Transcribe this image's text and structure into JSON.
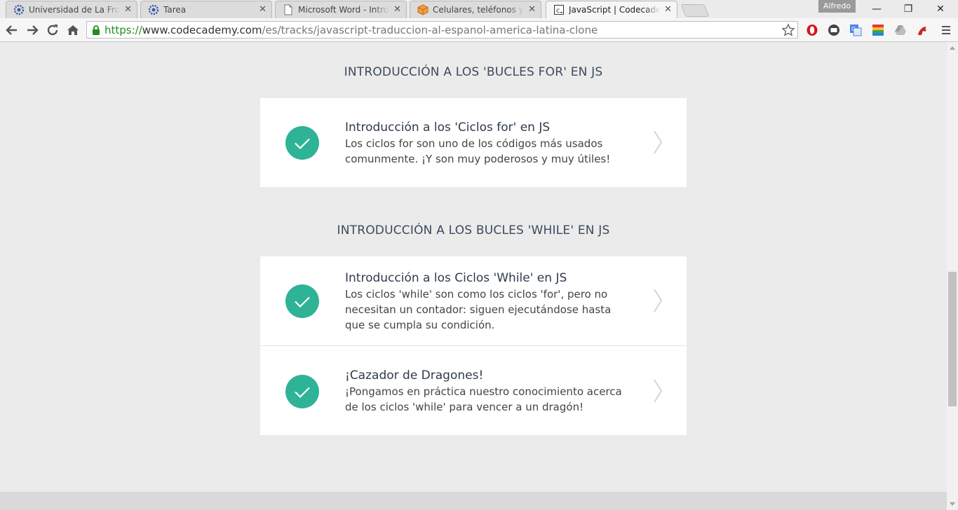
{
  "browser": {
    "tabs": [
      {
        "title": "Universidad de La Frontera",
        "favicon": "university-gear-icon",
        "active": false
      },
      {
        "title": "Tarea",
        "favicon": "university-gear-icon",
        "active": false
      },
      {
        "title": "Microsoft Word - Introducción",
        "favicon": "document-icon",
        "active": false
      },
      {
        "title": "Celulares, teléfonos y accesorios",
        "favicon": "box-icon",
        "active": false
      },
      {
        "title": "JavaScript | Codecademy",
        "favicon": "codecademy-icon",
        "active": true
      }
    ],
    "close_glyph": "✕",
    "profile_name": "Alfredo",
    "window_controls": {
      "minimize": "—",
      "restore": "❐",
      "close": "✕"
    },
    "address": {
      "scheme": "https://",
      "host": "www.codecademy.com",
      "path": "/es/tracks/javascript-traduccion-al-espanol-america-latina-clone"
    },
    "extensions": [
      "opera-icon",
      "screenshot-icon",
      "translate-icon",
      "color-grid-icon",
      "drive-icon",
      "dragon-icon"
    ],
    "colors": {
      "secure_green": "#1f8e1f"
    }
  },
  "page": {
    "colors": {
      "check_teal": "#2eb397",
      "title_text": "#3c4a5e",
      "background": "#ebebeb"
    },
    "sections": [
      {
        "heading": "INTRODUCCIÓN A LOS 'BUCLES FOR' EN JS",
        "items": [
          {
            "title": "Introducción a los 'Ciclos for' en JS",
            "description": "Los ciclos for son uno de los códigos más usados comunmente. ¡Y son muy poderosos y muy útiles!",
            "completed": true
          }
        ]
      },
      {
        "heading": "INTRODUCCIÓN A LOS BUCLES 'WHILE' EN JS",
        "items": [
          {
            "title": "Introducción a los Ciclos 'While' en JS",
            "description": "Los ciclos 'while' son como los ciclos 'for', pero no necesitan un contador: siguen ejecutándose hasta que se cumpla su condición.",
            "completed": true
          },
          {
            "title": "¡Cazador de Dragones!",
            "description": "¡Pongamos en práctica nuestro conocimiento acerca de los ciclos 'while' para vencer a un dragón!",
            "completed": true
          }
        ]
      }
    ]
  }
}
